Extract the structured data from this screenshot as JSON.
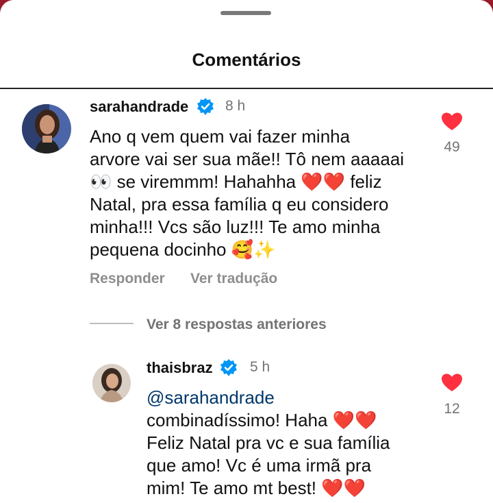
{
  "header": {
    "title": "Comentários"
  },
  "comment": {
    "username": "sarahandrade",
    "time": "8 h",
    "lines": [
      "Ano q vem quem vai fazer minha",
      "arvore vai ser sua mãe!! Tô nem aaaaai",
      "👀 se viremmm! Hahahha ❤️❤️ feliz",
      "Natal, pra essa família q eu considero",
      "minha!!! Vcs são luz!!! Te amo minha",
      "pequena docinho 🥰✨"
    ],
    "likes": "49",
    "reply_label": "Responder",
    "translate_label": "Ver tradução"
  },
  "view_previous": "Ver 8 respostas anteriores",
  "reply": {
    "username": "thaisbraz",
    "time": "5 h",
    "mention": "@sarahandrade",
    "lines": [
      "combinadíssimo! Haha ❤️❤️",
      "Feliz Natal pra vc e sua família",
      "que amo! Vc é uma irmã pra",
      "mim! Te amo mt best! ❤️❤️"
    ],
    "likes": "12"
  },
  "colors": {
    "heart": "#ff3040",
    "verified": "#0095f6",
    "mention": "#00376b"
  }
}
